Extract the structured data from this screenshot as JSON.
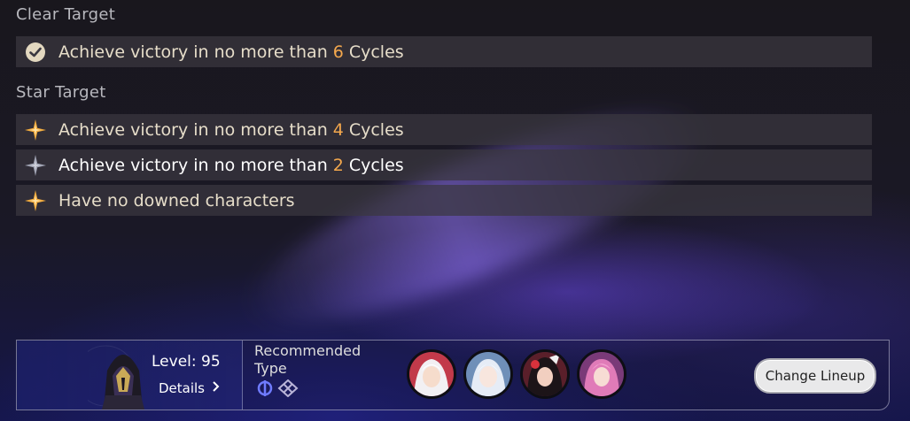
{
  "clear": {
    "title": "Clear Target",
    "items": [
      {
        "prefix": "Achieve victory in no more than",
        "number": "6",
        "suffix": "Cycles",
        "icon": "check-circle-icon"
      }
    ]
  },
  "star": {
    "title": "Star Target",
    "items": [
      {
        "prefix": "Achieve victory in no more than",
        "number": "4",
        "suffix": "Cycles",
        "icon": "star-gold-icon"
      },
      {
        "prefix": "Achieve victory in no more than",
        "number": "2",
        "suffix": "Cycles",
        "icon": "star-grey-icon"
      },
      {
        "text": "Have no downed characters",
        "icon": "star-gold-icon"
      }
    ]
  },
  "lineup": {
    "level": "Level: 95",
    "details": "Details",
    "recommended": "Recommended Type",
    "change_button": "Change Lineup",
    "type_icons": [
      "imaginary-type-icon",
      "quantum-type-icon"
    ],
    "avatars": [
      "avatar-1",
      "avatar-2",
      "avatar-3",
      "avatar-4"
    ]
  },
  "colors": {
    "accent_number": "#f4a84d",
    "gold": "#f0a93b",
    "grey_star": "#9da0b0",
    "text": "#e6ddc9"
  }
}
